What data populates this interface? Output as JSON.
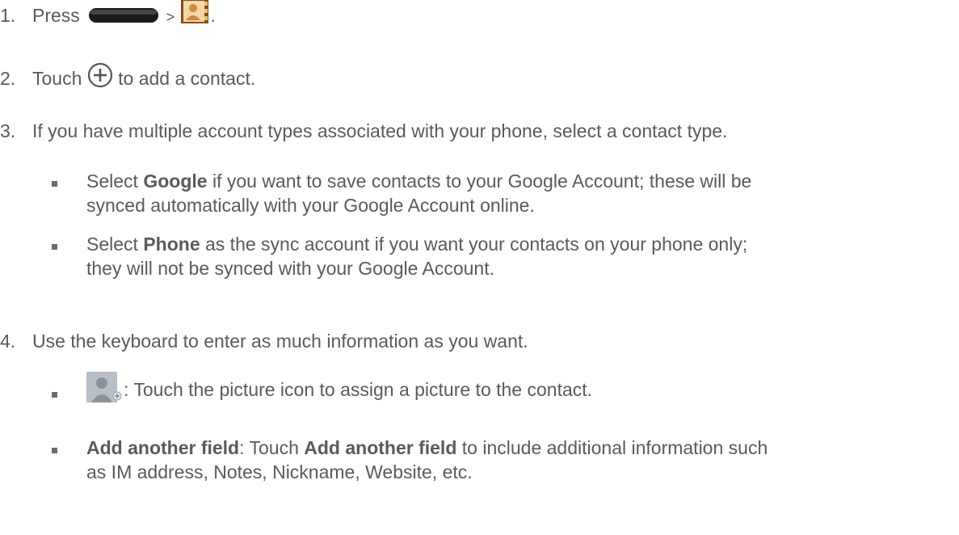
{
  "steps": [
    {
      "num": "1.",
      "before": "Press",
      "between": ">",
      "after": ".",
      "icons": [
        "home-button-icon",
        "contacts-app-icon"
      ]
    },
    {
      "num": "2.",
      "before": "Touch",
      "after": "to add a contact.",
      "icons": [
        "add-circle-icon"
      ]
    },
    {
      "num": "3.",
      "text": "If you have multiple account types associated with your phone, select a contact type."
    },
    {
      "num": "4.",
      "text": "Use the keyboard to enter as much information as you want."
    }
  ],
  "step3_bullets": [
    {
      "pre": "Select ",
      "bold": "Google",
      "line1": " if you want to save contacts to your Google Account; these will be",
      "line2": "synced automatically with your Google Account online."
    },
    {
      "pre": "Select ",
      "bold": "Phone",
      "line1": " as the sync account if you want your contacts on your phone only;",
      "line2": "they will not be synced with your Google Account."
    }
  ],
  "step4_bullets": [
    {
      "icon": "contact-picture-icon",
      "line1": ": Touch the picture icon to assign a picture to the contact."
    },
    {
      "bold": "Add another field",
      "mid": ": Touch ",
      "bold2": "Add another field",
      "line1": " to include additional information such",
      "line2": "as IM address, Notes, Nickname, Website, etc."
    }
  ]
}
